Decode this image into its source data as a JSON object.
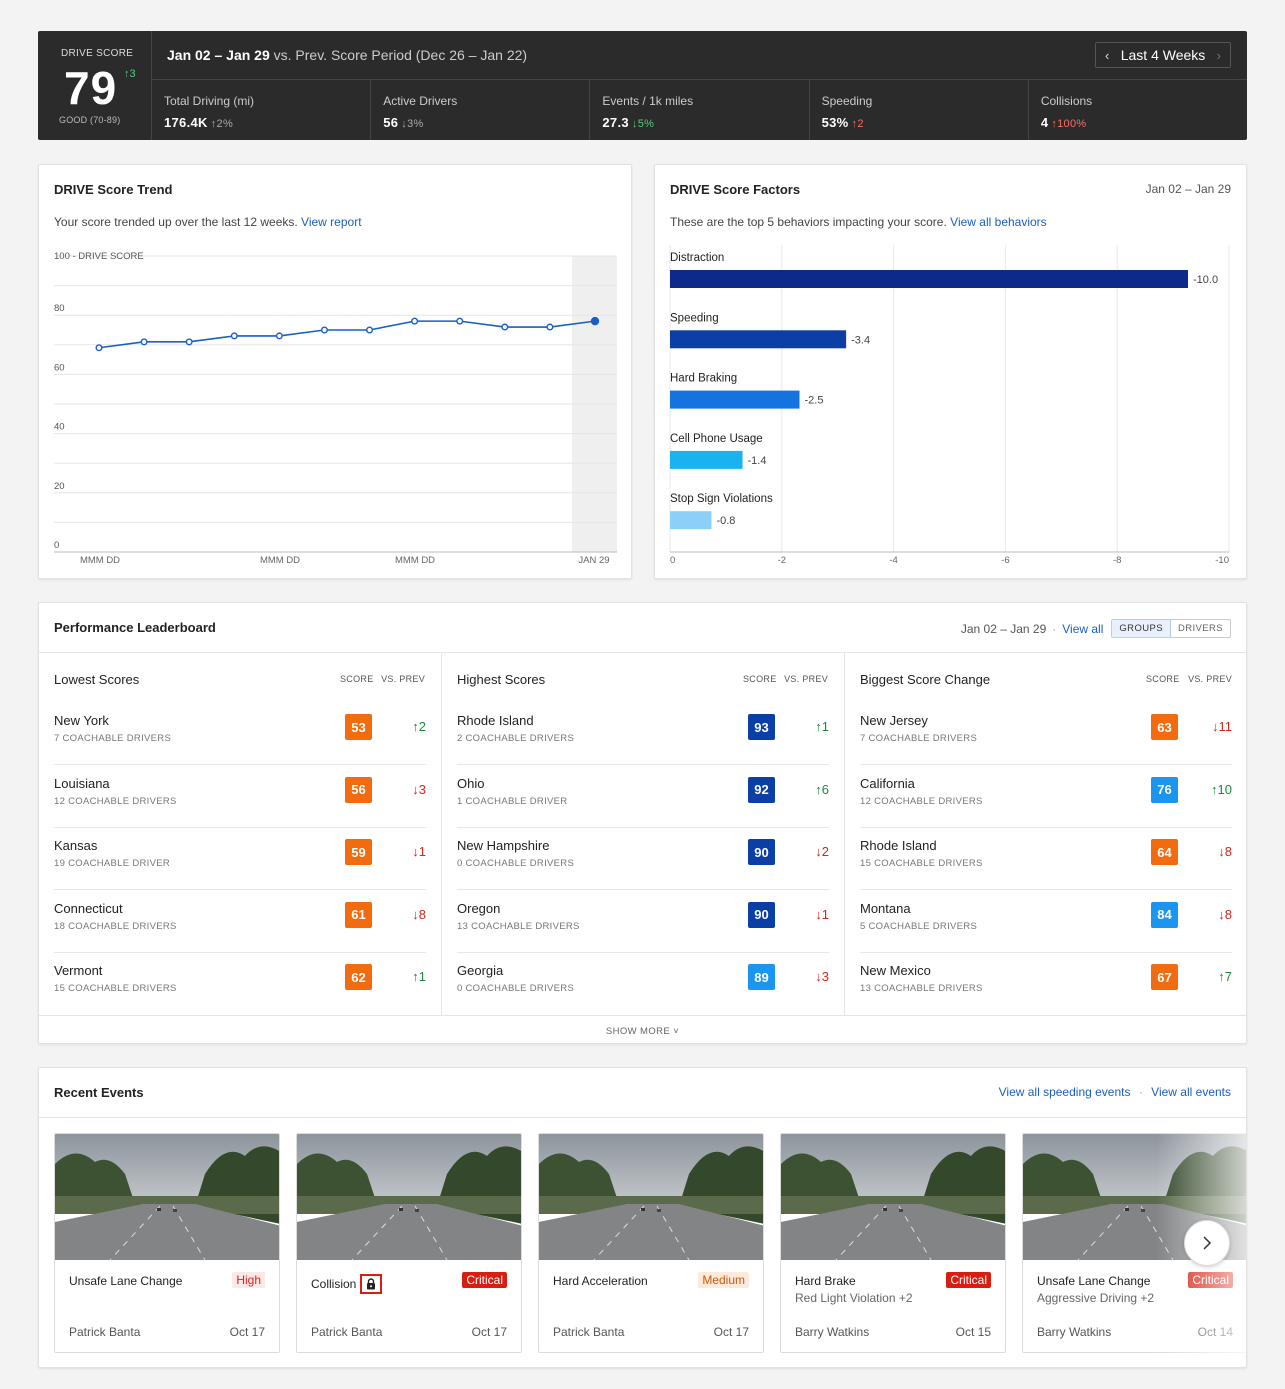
{
  "summary": {
    "score_label": "DRIVE SCORE",
    "score": "79",
    "score_delta": "↑3",
    "score_range": "GOOD (70-89)",
    "period_current": "Jan 02 – Jan 29",
    "period_compare": " vs. Prev. Score Period (Dec 26 – Jan 22)",
    "range_button": "Last 4 Weeks",
    "metrics": [
      {
        "label": "Total Driving (mi)",
        "value": "176.4K",
        "delta": "↑2%",
        "tone": "grey"
      },
      {
        "label": "Active Drivers",
        "value": "56",
        "delta": "↓3%",
        "tone": "grey"
      },
      {
        "label": "Events / 1k miles",
        "value": "27.3",
        "delta": "↓5%",
        "tone": "green"
      },
      {
        "label": "Speeding",
        "value": "53%",
        "delta": "↑2",
        "tone": "red"
      },
      {
        "label": "Collisions",
        "value": "4",
        "delta": "↑100%",
        "tone": "red"
      }
    ],
    "colors": {
      "bg": "#2b2b2b",
      "positive": "#4ccf7a",
      "negative": "#ff6b5f"
    }
  },
  "trend": {
    "title": "DRIVE Score Trend",
    "subtitle": "Your score trended up over the last 12 weeks.",
    "link": "View report"
  },
  "factors": {
    "title": "DRIVE Score Factors",
    "date": "Jan 02 – Jan 29",
    "subtitle": "These are the top 5 behaviors impacting your score.",
    "link": "View all behaviors"
  },
  "chart_data": [
    {
      "type": "line",
      "ylabel": "100 - DRIVE SCORE",
      "ylim": [
        0,
        100
      ],
      "yticks": [
        0,
        20,
        40,
        60,
        80
      ],
      "x_tick_labels": [
        "MMM DD",
        "MMM DD",
        "MMM DD",
        "JAN 29"
      ],
      "values": [
        69,
        71,
        71,
        73,
        73,
        75,
        75,
        78,
        78,
        76,
        76,
        78
      ],
      "highlight_last": true,
      "grid": true,
      "color": "#1a5fc4"
    },
    {
      "type": "bar",
      "orientation": "horizontal",
      "categories": [
        "Distraction",
        "Speeding",
        "Hard Braking",
        "Cell Phone Usage",
        "Stop Sign Violations"
      ],
      "values": [
        -10.0,
        -3.4,
        -2.5,
        -1.4,
        -0.8
      ],
      "value_labels": [
        "-10.0",
        "-3.4",
        "-2.5",
        "-1.4",
        "-0.8"
      ],
      "xlim": [
        0,
        -10
      ],
      "xticks": [
        "0",
        "-2",
        "-4",
        "-6",
        "-8",
        "-10"
      ],
      "colors": [
        "#0d2a8a",
        "#0c3fa6",
        "#1573e0",
        "#1ab3f0",
        "#8ccff7"
      ]
    }
  ],
  "leaderboard": {
    "title": "Performance Leaderboard",
    "date": "Jan 02 – Jan 29",
    "view_all": "View all",
    "seg_groups": "GROUPS",
    "seg_drivers": "DRIVERS",
    "score_hd": "SCORE",
    "prev_hd": "VS. PREV",
    "show_more": "SHOW MORE",
    "columns": [
      {
        "title": "Lowest Scores",
        "rows": [
          {
            "name": "New York",
            "count": "7 COACHABLE DRIVERS",
            "score": "53",
            "delta": "↑2",
            "dir": "up",
            "color": "#f26b0f"
          },
          {
            "name": "Louisiana",
            "count": "12 COACHABLE DRIVERS",
            "score": "56",
            "delta": "↓3",
            "dir": "down",
            "color": "#f26b0f"
          },
          {
            "name": "Kansas",
            "count": "19 COACHABLE DRIVER",
            "score": "59",
            "delta": "↓1",
            "dir": "down",
            "color": "#f26b0f"
          },
          {
            "name": "Connecticut",
            "count": "18 COACHABLE DRIVERS",
            "score": "61",
            "delta": "↓8",
            "dir": "down",
            "color": "#f26b0f"
          },
          {
            "name": "Vermont",
            "count": "15 COACHABLE DRIVERS",
            "score": "62",
            "delta": "↑1",
            "dir": "up",
            "color": "#f26b0f"
          }
        ]
      },
      {
        "title": "Highest Scores",
        "rows": [
          {
            "name": "Rhode Island",
            "count": "2 COACHABLE DRIVERS",
            "score": "93",
            "delta": "↑1",
            "dir": "up",
            "color": "#0c3fa6"
          },
          {
            "name": "Ohio",
            "count": "1 COACHABLE DRIVER",
            "score": "92",
            "delta": "↑6",
            "dir": "up",
            "color": "#0c3fa6"
          },
          {
            "name": "New Hampshire",
            "count": "0 COACHABLE DRIVERS",
            "score": "90",
            "delta": "↓2",
            "dir": "down",
            "color": "#0c3fa6"
          },
          {
            "name": "Oregon",
            "count": "13 COACHABLE DRIVERS",
            "score": "90",
            "delta": "↓1",
            "dir": "down",
            "color": "#0c3fa6"
          },
          {
            "name": "Georgia",
            "count": "0 COACHABLE DRIVERS",
            "score": "89",
            "delta": "↓3",
            "dir": "down",
            "color": "#1a95f0"
          }
        ]
      },
      {
        "title": "Biggest Score Change",
        "rows": [
          {
            "name": "New Jersey",
            "count": "7 COACHABLE DRIVERS",
            "score": "63",
            "delta": "↓11",
            "dir": "down",
            "color": "#f26b0f"
          },
          {
            "name": "California",
            "count": "12 COACHABLE DRIVERS",
            "score": "76",
            "delta": "↑10",
            "dir": "up",
            "color": "#1a95f0"
          },
          {
            "name": "Rhode Island",
            "count": "15 COACHABLE DRIVERS",
            "score": "64",
            "delta": "↓8",
            "dir": "down",
            "color": "#f26b0f"
          },
          {
            "name": "Montana",
            "count": "5 COACHABLE DRIVERS",
            "score": "84",
            "delta": "↓8",
            "dir": "down",
            "color": "#1a95f0"
          },
          {
            "name": "New Mexico",
            "count": "13 COACHABLE DRIVERS",
            "score": "67",
            "delta": "↑7",
            "dir": "up",
            "color": "#f26b0f"
          }
        ]
      }
    ]
  },
  "events": {
    "title": "Recent Events",
    "link_speeding": "View all speeding events",
    "link_all": "View all events",
    "cards": [
      {
        "type": "Unsafe Lane Change",
        "sub": "",
        "badge": "High",
        "level": "high",
        "driver": "Patrick Banta",
        "date": "Oct 17",
        "locked": false
      },
      {
        "type": "Collision",
        "sub": "",
        "badge": "Critical",
        "level": "crit",
        "driver": "Patrick Banta",
        "date": "Oct 17",
        "locked": true
      },
      {
        "type": "Hard Acceleration",
        "sub": "",
        "badge": "Medium",
        "level": "med",
        "driver": "Patrick Banta",
        "date": "Oct 17",
        "locked": false
      },
      {
        "type": "Hard Brake",
        "sub": "Red Light Violation +2",
        "badge": "Critical",
        "level": "crit",
        "driver": "Barry Watkins",
        "date": "Oct 15",
        "locked": false
      },
      {
        "type": "Unsafe Lane Change",
        "sub": "Aggressive Driving +2",
        "badge": "Critical",
        "level": "crit",
        "driver": "Barry Watkins",
        "date": "Oct 14",
        "locked": false
      }
    ]
  }
}
